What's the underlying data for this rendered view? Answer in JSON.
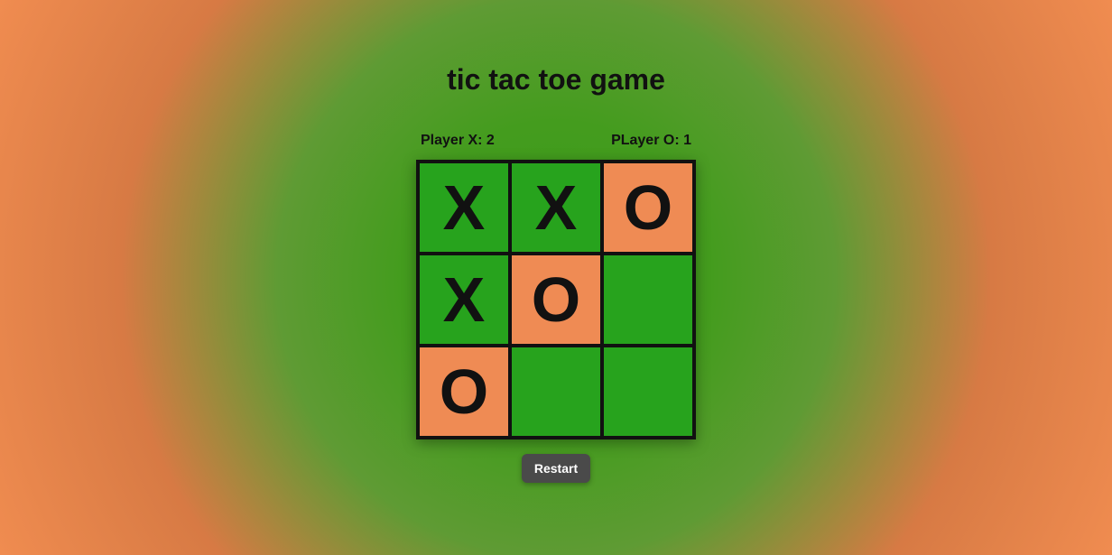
{
  "title": "tic tac toe game",
  "scores": {
    "x_label": "Player X: 2",
    "o_label": "PLayer O: 1",
    "x_value": 2,
    "o_value": 1
  },
  "board": {
    "cells": [
      {
        "mark": "X",
        "color": "green"
      },
      {
        "mark": "X",
        "color": "green"
      },
      {
        "mark": "O",
        "color": "orange"
      },
      {
        "mark": "X",
        "color": "green"
      },
      {
        "mark": "O",
        "color": "orange"
      },
      {
        "mark": "",
        "color": "green"
      },
      {
        "mark": "O",
        "color": "orange"
      },
      {
        "mark": "",
        "color": "green"
      },
      {
        "mark": "",
        "color": "green"
      }
    ]
  },
  "buttons": {
    "restart": "Restart"
  },
  "colors": {
    "cell_green": "#27a31d",
    "cell_orange": "#ef8b54",
    "grid": "#111111"
  }
}
